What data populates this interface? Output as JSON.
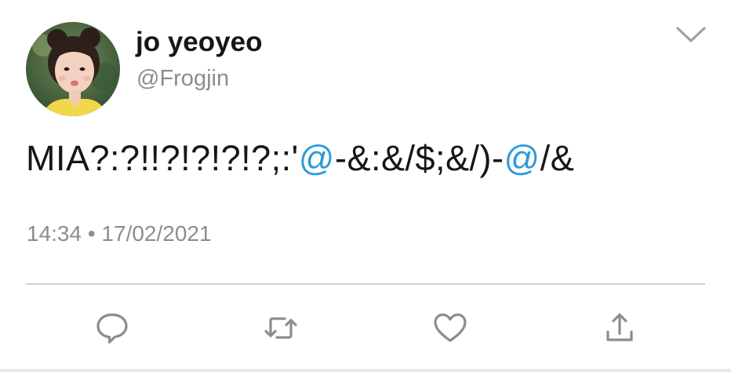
{
  "user": {
    "display_name": "jo yeoyeo",
    "handle": "@Frogjin",
    "avatar_icon": "profile-photo"
  },
  "tweet": {
    "text_part1": "MIA?:?!!?!?!?!?;:'",
    "mention1": "@",
    "text_part2": "-&:&/$;&/)-",
    "mention2": "@",
    "text_part3": "/&",
    "timestamp": "14:34 • 17/02/2021"
  },
  "menu": {
    "icon": "chevron-down-icon"
  },
  "actions": {
    "reply_icon": "reply-icon",
    "retweet_icon": "retweet-icon",
    "like_icon": "heart-icon",
    "share_icon": "share-icon"
  },
  "colors": {
    "text": "#14171a",
    "secondary": "#8a8d91",
    "link": "#2f9bd9",
    "divider": "#cfd3d6",
    "icon": "#8a8d91"
  }
}
